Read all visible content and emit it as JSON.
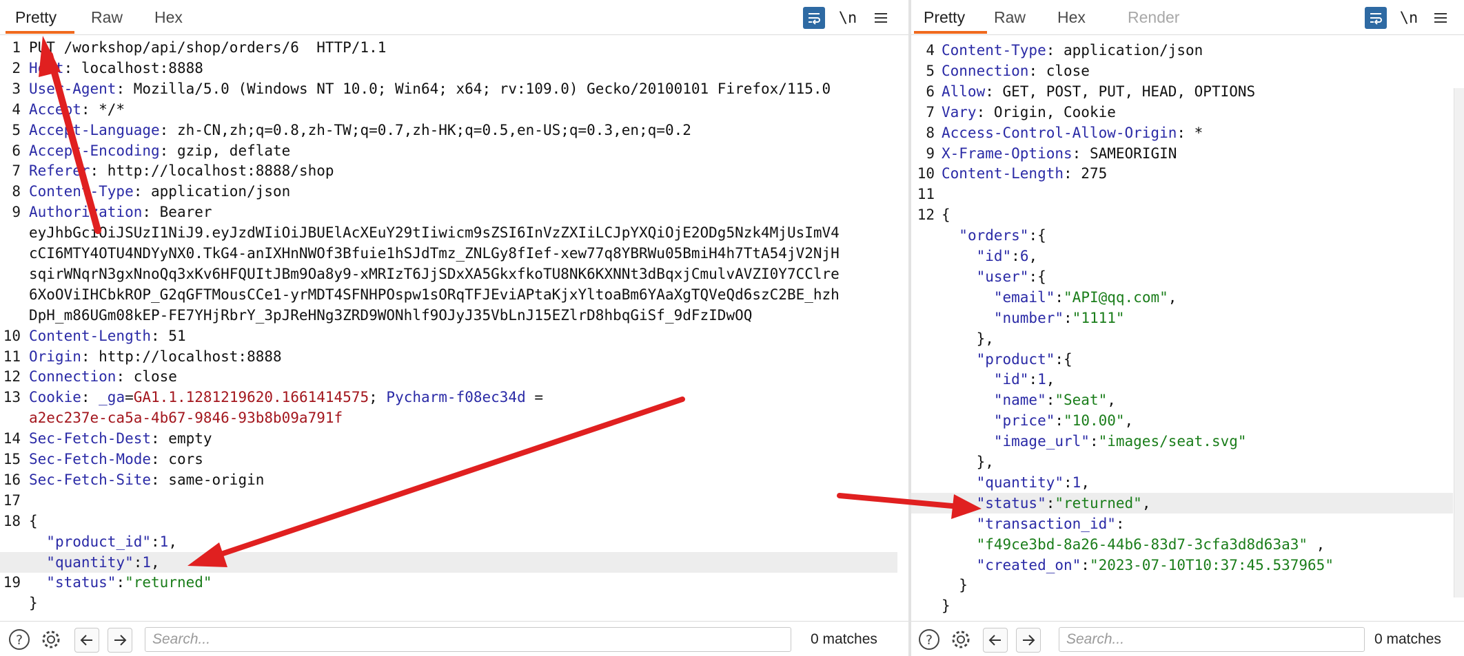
{
  "request": {
    "tabs": [
      "Pretty",
      "Raw",
      "Hex"
    ],
    "newline_label": "\\n",
    "icons": {
      "wrap": "word-wrap-icon",
      "newline": "newline-icon",
      "menu": "hamburger-menu-icon"
    },
    "lines": [
      {
        "n": "1",
        "segs": [
          {
            "t": "PUT /workshop/api/shop/orders/6  HTTP/1.1"
          }
        ]
      },
      {
        "n": "2",
        "segs": [
          {
            "t": "Host",
            "c": "k"
          },
          {
            "t": ": localhost:8888"
          }
        ]
      },
      {
        "n": "3",
        "segs": [
          {
            "t": "User-Agent",
            "c": "k"
          },
          {
            "t": ": Mozilla/5.0 (Windows NT 10.0; Win64; x64; rv:109.0) Gecko/20100101 Firefox/115.0"
          }
        ]
      },
      {
        "n": "4",
        "segs": [
          {
            "t": "Accept",
            "c": "k"
          },
          {
            "t": ": */*"
          }
        ]
      },
      {
        "n": "5",
        "segs": [
          {
            "t": "Accept-Language",
            "c": "k"
          },
          {
            "t": ": zh-CN,zh;q=0.8,zh-TW;q=0.7,zh-HK;q=0.5,en-US;q=0.3,en;q=0.2"
          }
        ]
      },
      {
        "n": "6",
        "segs": [
          {
            "t": "Accept-Encoding",
            "c": "k"
          },
          {
            "t": ": gzip, deflate"
          }
        ]
      },
      {
        "n": "7",
        "segs": [
          {
            "t": "Referer",
            "c": "k"
          },
          {
            "t": ": http://localhost:8888/shop"
          }
        ]
      },
      {
        "n": "8",
        "segs": [
          {
            "t": "Content-Type",
            "c": "k"
          },
          {
            "t": ": application/json"
          }
        ]
      },
      {
        "n": "9",
        "segs": [
          {
            "t": "Authorization",
            "c": "k"
          },
          {
            "t": ": Bearer"
          }
        ]
      },
      {
        "n": "",
        "segs": [
          {
            "t": "eyJhbGciOiJSUzI1NiJ9.eyJzdWIiOiJBUElAcXEuY29tIiwicm9sZSI6InVzZXIiLCJpYXQiOjE2ODg5Nzk4MjUsImV4"
          }
        ]
      },
      {
        "n": "",
        "segs": [
          {
            "t": "cCI6MTY4OTU4NDYyNX0.TkG4-anIXHnNWOf3Bfuie1hSJdTmz_ZNLGy8fIef-xew77q8YBRWu05BmiH4h7TtA54jV2NjH"
          }
        ]
      },
      {
        "n": "",
        "segs": [
          {
            "t": "sqirWNqrN3gxNnoQq3xKv6HFQUItJBm9Oa8y9-xMRIzT6JjSDxXA5GkxfkoTU8NK6KXNNt3dBqxjCmulvAVZI0Y7CClre"
          }
        ]
      },
      {
        "n": "",
        "segs": [
          {
            "t": "6XoOViIHCbkROP_G2qGFTMousCCe1-yrMDT4SFNHPOspw1sORqTFJEviAPtaKjxYltoaBm6YAaXgTQVeQd6szC2BE_hzh"
          }
        ]
      },
      {
        "n": "",
        "segs": [
          {
            "t": "DpH_m86UGm08kEP-FE7YHjRbrY_3pJReHNg3ZRD9WONhlf9OJyJ35VbLnJ15EZlrD8hbqGiSf_9dFzIDwOQ"
          }
        ]
      },
      {
        "n": "10",
        "segs": [
          {
            "t": "Content-Length",
            "c": "k"
          },
          {
            "t": ": 51"
          }
        ]
      },
      {
        "n": "11",
        "segs": [
          {
            "t": "Origin",
            "c": "k"
          },
          {
            "t": ": http://localhost:8888"
          }
        ]
      },
      {
        "n": "12",
        "segs": [
          {
            "t": "Connection",
            "c": "k"
          },
          {
            "t": ": close"
          }
        ]
      },
      {
        "n": "13",
        "segs": [
          {
            "t": "Cookie",
            "c": "k"
          },
          {
            "t": ": "
          },
          {
            "t": "_ga",
            "c": "k"
          },
          {
            "t": "="
          },
          {
            "t": "GA1.1.1281219620.1661414575",
            "c": "r"
          },
          {
            "t": "; "
          },
          {
            "t": "Pycharm-f08ec34d",
            "c": "k"
          },
          {
            "t": " ="
          }
        ]
      },
      {
        "n": "",
        "segs": [
          {
            "t": "a2ec237e-ca5a-4b67-9846-93b8b09a791f",
            "c": "r"
          }
        ]
      },
      {
        "n": "14",
        "segs": [
          {
            "t": "Sec-Fetch-Dest",
            "c": "k"
          },
          {
            "t": ": empty"
          }
        ]
      },
      {
        "n": "15",
        "segs": [
          {
            "t": "Sec-Fetch-Mode",
            "c": "k"
          },
          {
            "t": ": cors"
          }
        ]
      },
      {
        "n": "16",
        "segs": [
          {
            "t": "Sec-Fetch-Site",
            "c": "k"
          },
          {
            "t": ": same-origin"
          }
        ]
      },
      {
        "n": "17",
        "segs": []
      },
      {
        "n": "18",
        "segs": [
          {
            "t": "{"
          }
        ]
      },
      {
        "n": "",
        "segs": [
          {
            "t": "  "
          },
          {
            "t": "\"product_id\"",
            "c": "k"
          },
          {
            "t": ":"
          },
          {
            "t": "1",
            "c": "n"
          },
          {
            "t": ","
          }
        ]
      },
      {
        "n": "",
        "segs": [
          {
            "t": "  "
          },
          {
            "t": "\"quantity\"",
            "c": "k"
          },
          {
            "t": ":"
          },
          {
            "t": "1",
            "c": "n"
          },
          {
            "t": ","
          }
        ],
        "hl": true
      },
      {
        "n": "19",
        "segs": [
          {
            "t": "  "
          },
          {
            "t": "\"status\"",
            "c": "k"
          },
          {
            "t": ":"
          },
          {
            "t": "\"returned\"",
            "c": "s"
          }
        ]
      },
      {
        "n": "",
        "segs": [
          {
            "t": "}"
          }
        ]
      }
    ],
    "search_placeholder": "Search...",
    "matches": "0 matches"
  },
  "response": {
    "tabs": [
      "Pretty",
      "Raw",
      "Hex",
      "Render"
    ],
    "newline_label": "\\n",
    "icons": {
      "wrap": "word-wrap-icon",
      "newline": "newline-icon",
      "menu": "hamburger-menu-icon"
    },
    "lines": [
      {
        "n": "4",
        "segs": [
          {
            "t": "Content-Type",
            "c": "k"
          },
          {
            "t": ": application/json"
          }
        ]
      },
      {
        "n": "5",
        "segs": [
          {
            "t": "Connection",
            "c": "k"
          },
          {
            "t": ": close"
          }
        ]
      },
      {
        "n": "6",
        "segs": [
          {
            "t": "Allow",
            "c": "k"
          },
          {
            "t": ": GET, POST, PUT, HEAD, OPTIONS"
          }
        ]
      },
      {
        "n": "7",
        "segs": [
          {
            "t": "Vary",
            "c": "k"
          },
          {
            "t": ": Origin, Cookie"
          }
        ]
      },
      {
        "n": "8",
        "segs": [
          {
            "t": "Access-Control-Allow-Origin",
            "c": "k"
          },
          {
            "t": ": *"
          }
        ]
      },
      {
        "n": "9",
        "segs": [
          {
            "t": "X-Frame-Options",
            "c": "k"
          },
          {
            "t": ": SAMEORIGIN"
          }
        ]
      },
      {
        "n": "10",
        "segs": [
          {
            "t": "Content-Length",
            "c": "k"
          },
          {
            "t": ": 275"
          }
        ]
      },
      {
        "n": "11",
        "segs": []
      },
      {
        "n": "12",
        "segs": [
          {
            "t": "{"
          }
        ]
      },
      {
        "n": "",
        "segs": [
          {
            "t": "  "
          },
          {
            "t": "\"orders\"",
            "c": "k"
          },
          {
            "t": ":{"
          }
        ]
      },
      {
        "n": "",
        "segs": [
          {
            "t": "    "
          },
          {
            "t": "\"id\"",
            "c": "k"
          },
          {
            "t": ":"
          },
          {
            "t": "6",
            "c": "n"
          },
          {
            "t": ","
          }
        ]
      },
      {
        "n": "",
        "segs": [
          {
            "t": "    "
          },
          {
            "t": "\"user\"",
            "c": "k"
          },
          {
            "t": ":{"
          }
        ]
      },
      {
        "n": "",
        "segs": [
          {
            "t": "      "
          },
          {
            "t": "\"email\"",
            "c": "k"
          },
          {
            "t": ":"
          },
          {
            "t": "\"API@qq.com\"",
            "c": "s"
          },
          {
            "t": ","
          }
        ]
      },
      {
        "n": "",
        "segs": [
          {
            "t": "      "
          },
          {
            "t": "\"number\"",
            "c": "k"
          },
          {
            "t": ":"
          },
          {
            "t": "\"1111\"",
            "c": "s"
          }
        ]
      },
      {
        "n": "",
        "segs": [
          {
            "t": "    },"
          }
        ]
      },
      {
        "n": "",
        "segs": [
          {
            "t": "    "
          },
          {
            "t": "\"product\"",
            "c": "k"
          },
          {
            "t": ":{"
          }
        ]
      },
      {
        "n": "",
        "segs": [
          {
            "t": "      "
          },
          {
            "t": "\"id\"",
            "c": "k"
          },
          {
            "t": ":"
          },
          {
            "t": "1",
            "c": "n"
          },
          {
            "t": ","
          }
        ]
      },
      {
        "n": "",
        "segs": [
          {
            "t": "      "
          },
          {
            "t": "\"name\"",
            "c": "k"
          },
          {
            "t": ":"
          },
          {
            "t": "\"Seat\"",
            "c": "s"
          },
          {
            "t": ","
          }
        ]
      },
      {
        "n": "",
        "segs": [
          {
            "t": "      "
          },
          {
            "t": "\"price\"",
            "c": "k"
          },
          {
            "t": ":"
          },
          {
            "t": "\"10.00\"",
            "c": "s"
          },
          {
            "t": ","
          }
        ]
      },
      {
        "n": "",
        "segs": [
          {
            "t": "      "
          },
          {
            "t": "\"image_url\"",
            "c": "k"
          },
          {
            "t": ":"
          },
          {
            "t": "\"images/seat.svg\"",
            "c": "s"
          }
        ]
      },
      {
        "n": "",
        "segs": [
          {
            "t": "    },"
          }
        ]
      },
      {
        "n": "",
        "segs": [
          {
            "t": "    "
          },
          {
            "t": "\"quantity\"",
            "c": "k"
          },
          {
            "t": ":"
          },
          {
            "t": "1",
            "c": "n"
          },
          {
            "t": ","
          }
        ]
      },
      {
        "n": "",
        "segs": [
          {
            "t": "    "
          },
          {
            "t": "\"status\"",
            "c": "k"
          },
          {
            "t": ":"
          },
          {
            "t": "\"returned\"",
            "c": "s"
          },
          {
            "t": ","
          }
        ],
        "hl": true
      },
      {
        "n": "",
        "segs": [
          {
            "t": "    "
          },
          {
            "t": "\"transaction_id\"",
            "c": "k"
          },
          {
            "t": ":"
          }
        ]
      },
      {
        "n": "",
        "segs": [
          {
            "t": "    "
          },
          {
            "t": "\"f49ce3bd-8a26-44b6-83d7-3cfa3d8d63a3\"",
            "c": "s"
          },
          {
            "t": " ,"
          }
        ]
      },
      {
        "n": "",
        "segs": [
          {
            "t": "    "
          },
          {
            "t": "\"created_on\"",
            "c": "k"
          },
          {
            "t": ":"
          },
          {
            "t": "\"2023-07-10T10:37:45.537965\"",
            "c": "s"
          }
        ]
      },
      {
        "n": "",
        "segs": [
          {
            "t": "  }"
          }
        ]
      },
      {
        "n": "",
        "segs": [
          {
            "t": "}"
          }
        ]
      }
    ],
    "search_placeholder": "Search...",
    "matches": "0 matches"
  },
  "colors": {
    "accent": "#f06a1e",
    "header_key": "#2a2aa6",
    "string": "#1a7d1a",
    "cookie_value": "#a3161d",
    "arrow": "#e02020",
    "wrap_button": "#2e6aa3"
  }
}
